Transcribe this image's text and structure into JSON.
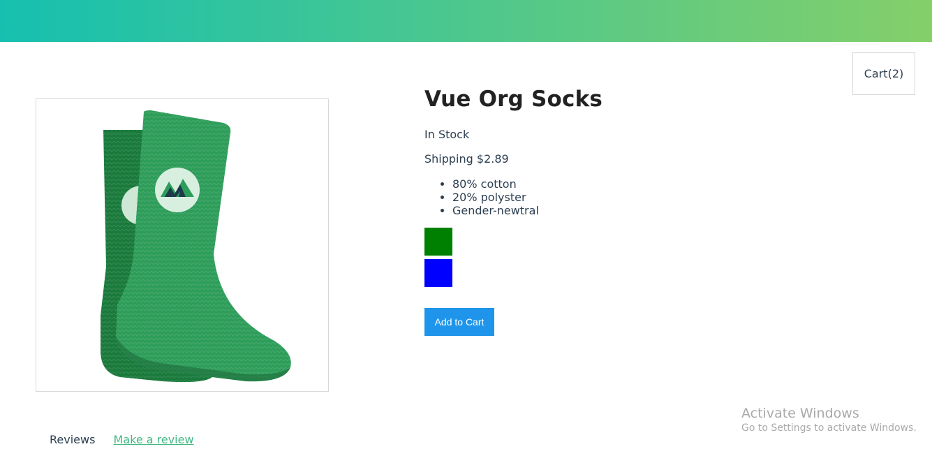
{
  "header": {
    "gradient_start": "#16c0b0",
    "gradient_end": "#84cf6a"
  },
  "cart": {
    "label": "Cart(2)"
  },
  "product": {
    "image_icon": "green-sock-image",
    "title": "Vue Org Socks",
    "stock_status": "In Stock",
    "shipping": "Shipping $2.89",
    "details": [
      "80% cotton",
      "20% polyster",
      "Gender-newtral"
    ],
    "variants": [
      {
        "color": "#008000"
      },
      {
        "color": "#0000ff"
      }
    ],
    "add_to_cart_label": "Add to Cart",
    "add_to_cart_color": "#1e95ea"
  },
  "tabs": [
    {
      "label": "Reviews"
    },
    {
      "label": "Make a review"
    }
  ],
  "watermark": {
    "title": "Activate Windows",
    "subtitle": "Go to Settings to activate Windows."
  }
}
